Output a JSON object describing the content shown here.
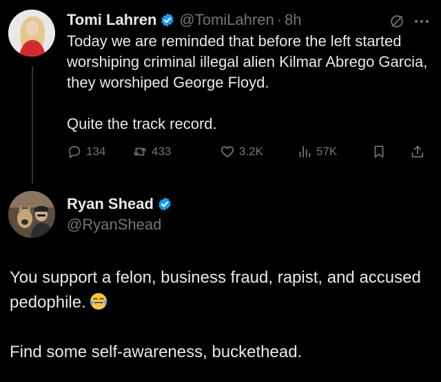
{
  "colors": {
    "background": "#000000",
    "text": "#e7e9ea",
    "muted": "#71767b",
    "verified": "#1d9bf0",
    "thread_line": "#333639"
  },
  "tweet1": {
    "name": "Tomi Lahren",
    "handle": "@TomiLahren",
    "separator": "·",
    "time": "8h",
    "avatar_icon": "profile-photo",
    "text_1": "Today we are reminded that before the left started worshiping criminal illegal alien Kilmar Abrego Garcia, they worshiped George Floyd.",
    "text_2": "Quite the track record.",
    "actions": {
      "replies": "134",
      "reposts": "433",
      "likes": "3.2K",
      "views": "57K"
    },
    "icons": [
      "verified-icon",
      "grok-icon",
      "more-icon",
      "reply-icon",
      "repost-icon",
      "like-icon",
      "views-icon",
      "bookmark-icon",
      "share-icon"
    ]
  },
  "tweet2": {
    "name": "Ryan Shead",
    "handle": "@RyanShead",
    "avatar_icon": "profile-photo",
    "text_1": "You support a felon, business fraud, rapist, and accused pedophile.",
    "text_1_emoji": "face-with-tears-of-joy-emoji",
    "text_2": "Find some self-awareness, buckethead."
  }
}
